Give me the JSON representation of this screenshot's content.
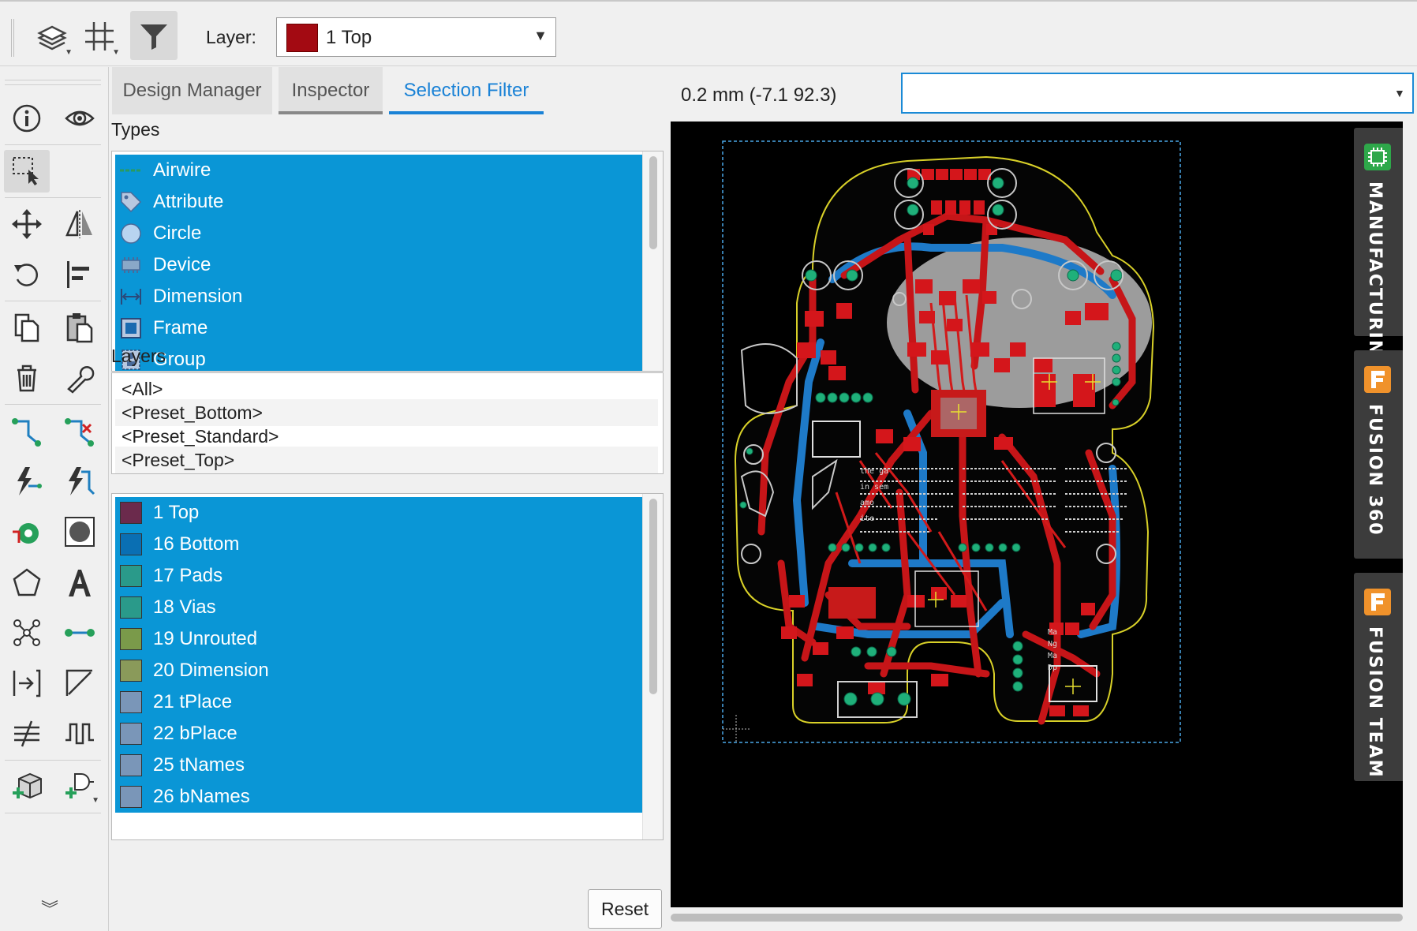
{
  "toolbar": {
    "layer_label": "Layer:",
    "layer_value": "1 Top",
    "layer_color": "#a30a12",
    "tools": [
      {
        "name": "layers-icon",
        "active": false
      },
      {
        "name": "grid-icon",
        "active": false
      },
      {
        "name": "filter-icon",
        "active": true
      }
    ]
  },
  "left_tools": [
    "info-icon",
    "eye-icon",
    "select-icon",
    "move-icon",
    "mirror-icon",
    "rotate-icon",
    "align-icon",
    "copy-icon",
    "paste-icon",
    "delete-icon",
    "wrench-icon",
    "route-icon",
    "ripup-icon",
    "autoroute-icon",
    "optimize-icon",
    "via-icon",
    "hole-icon",
    "polygon-icon",
    "text-icon",
    "net-icon",
    "wire-icon",
    "meander-icon",
    "arc-icon",
    "fanout-icon",
    "signal-icon",
    "add-part-icon",
    "add-gate-icon",
    "more-tools-icon"
  ],
  "panel": {
    "tabs": [
      {
        "label": "Design Manager",
        "active": false
      },
      {
        "label": "Inspector",
        "active": false
      },
      {
        "label": "Selection Filter",
        "active": true
      }
    ],
    "types_label": "Types",
    "types": [
      {
        "label": "Airwire",
        "icon": "airwire-icon"
      },
      {
        "label": "Attribute",
        "icon": "attribute-icon"
      },
      {
        "label": "Circle",
        "icon": "circle-icon"
      },
      {
        "label": "Device",
        "icon": "device-icon"
      },
      {
        "label": "Dimension",
        "icon": "dimension-icon"
      },
      {
        "label": "Frame",
        "icon": "frame-icon"
      },
      {
        "label": "Group",
        "icon": "group-icon"
      }
    ],
    "layers_label": "Layers",
    "presets": [
      "<All>",
      "<Preset_Bottom>",
      "<Preset_Standard>",
      "<Preset_Top>"
    ],
    "layers": [
      {
        "label": "1 Top",
        "color": "#6b2a4c"
      },
      {
        "label": "16 Bottom",
        "color": "#0a6fb3"
      },
      {
        "label": "17 Pads",
        "color": "#2a9a8a"
      },
      {
        "label": "18 Vias",
        "color": "#2a9a8a"
      },
      {
        "label": "19 Unrouted",
        "color": "#7a9a4a"
      },
      {
        "label": "20 Dimension",
        "color": "#8a9a5a"
      },
      {
        "label": "21 tPlace",
        "color": "#7a96b8"
      },
      {
        "label": "22 bPlace",
        "color": "#7a96b8"
      },
      {
        "label": "25 tNames",
        "color": "#7a96b8"
      },
      {
        "label": "26 bNames",
        "color": "#7a96b8"
      }
    ],
    "reset_label": "Reset"
  },
  "canvas": {
    "coordinates": "0.2 mm (-7.1 92.3)",
    "command_value": "",
    "silk_text": [
      "the ga",
      "in sem",
      "amo",
      "ite",
      "Ma",
      "Ng",
      "Ma",
      "Dp"
    ],
    "side_tabs": [
      {
        "label": "MANUFACTURING",
        "badge_color": "#2ea84a"
      },
      {
        "label": "FUSION 360",
        "badge_color": "#f0922b"
      },
      {
        "label": "FUSION TEAM",
        "badge_color": "#f0922b"
      }
    ]
  }
}
